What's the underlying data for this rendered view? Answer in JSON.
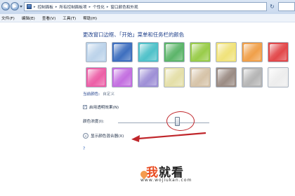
{
  "address_bar": {
    "crumbs": [
      "控制面板",
      "所有控制面板项",
      "个性化",
      "窗口颜色和外观"
    ],
    "back_glyph": "◀",
    "forward_glyph": "▶",
    "refresh_glyph": "↻"
  },
  "menu": [
    "文件(F)",
    "编辑(E)",
    "查看(V)",
    "工具(T)",
    "帮助(H)"
  ],
  "main": {
    "title": "更改窗口边框、「开始」菜单和任务栏的颜色",
    "swatch_colors": [
      [
        "#bcd3ea",
        "#3e6fbf",
        "#4fc1c9",
        "#5cb56a",
        "#99cc4a",
        "#f0e27a",
        "#f0a04a",
        "#e2484a"
      ],
      [
        "#ec5fa6",
        "#c36fe0",
        "#9e8fd6",
        "#e4dfa8",
        "#d6c3a8",
        "#9b8c84",
        "#b5b5b5",
        "#ededed"
      ]
    ],
    "current_color_label": "当前颜色:",
    "current_color_value": "自定义",
    "transparency": {
      "checked": true,
      "label": "启用透明效果(N)",
      "check_glyph": "✓"
    },
    "intensity_label": "颜色浓度(I):",
    "intensity_level_percent": 65,
    "mixer_toggle_glyph": "⌄",
    "mixer_label": "显示颜色混合器(X)",
    "help_glyph": "?"
  },
  "annotation": {
    "ring_color": "#c0262b",
    "arrow_color": "#c0262b"
  },
  "watermark": {
    "text_red": "我",
    "text_black": "就看",
    "url": "www.wojiukan.com"
  }
}
